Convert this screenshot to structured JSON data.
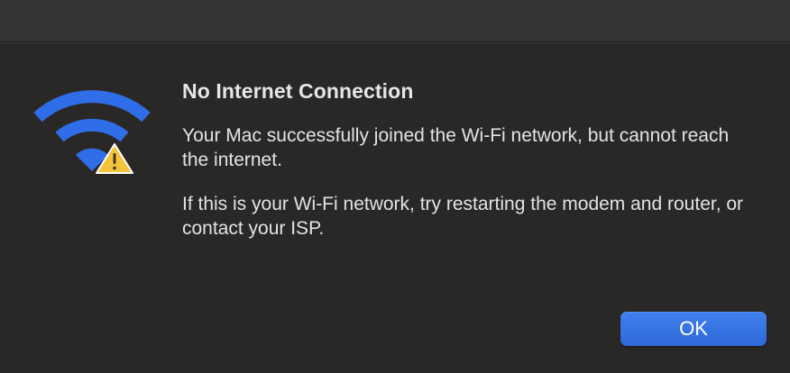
{
  "dialog": {
    "icon": "wifi-warning-icon",
    "title": "No Internet Connection",
    "message_primary": "Your Mac successfully joined the Wi-Fi network, but cannot reach the internet.",
    "message_secondary": "If this is your Wi-Fi network, try restarting the modem and router, or contact your ISP.",
    "ok_label": "OK"
  },
  "colors": {
    "background": "#2a2827",
    "titlebar": "#353433",
    "wifi_blue": "#2f6ee8",
    "warning_yellow": "#f2c33b",
    "button_blue": "#3574e4",
    "text": "#e3e3e3"
  }
}
